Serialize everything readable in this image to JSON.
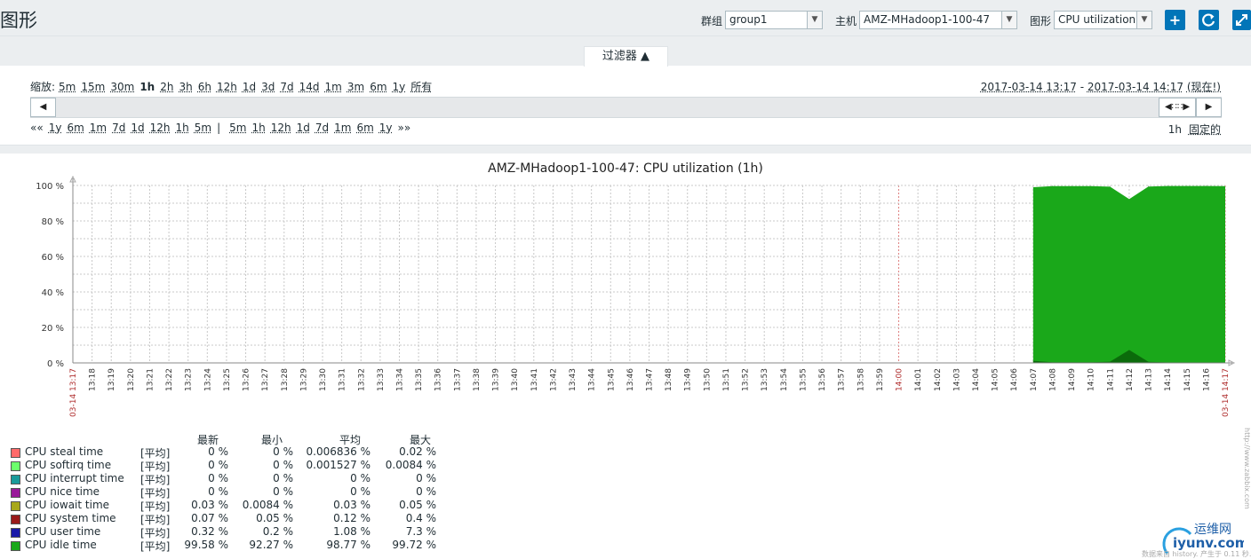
{
  "header": {
    "title": "图形",
    "group_label": "群组",
    "group_value": "group1",
    "host_label": "主机",
    "host_value": "AMZ-MHadoop1-100-47",
    "graph_label": "图形",
    "graph_value": "CPU utilization",
    "buttons": [
      "add",
      "refresh",
      "fullscreen"
    ]
  },
  "filter": {
    "tab_label": "过滤器 ▲",
    "zoom_label": "缩放:",
    "zoom_options": [
      "5m",
      "15m",
      "30m",
      "1h",
      "2h",
      "3h",
      "6h",
      "12h",
      "1d",
      "3d",
      "7d",
      "14d",
      "1m",
      "3m",
      "6m",
      "1y",
      "所有"
    ],
    "zoom_active": "1h",
    "range_from": "2017-03-14 13:17",
    "range_sep": " - ",
    "range_to": "2017-03-14 14:17",
    "range_now": "(现在!)",
    "nav_back_prefix": "««",
    "nav_back": [
      "1y",
      "6m",
      "1m",
      "7d",
      "1d",
      "12h",
      "1h",
      "5m"
    ],
    "nav_sep": "|",
    "nav_fwd": [
      "5m",
      "1h",
      "12h",
      "1d",
      "7d",
      "1m",
      "6m",
      "1y"
    ],
    "nav_fwd_suffix": "»»",
    "period_label": "1h",
    "fixed_label": "固定的"
  },
  "chart_data": {
    "type": "area",
    "title": "AMZ-MHadoop1-100-47: CPU utilization (1h)",
    "y_ticks": [
      "0 %",
      "20 %",
      "40 %",
      "60 %",
      "80 %",
      "100 %"
    ],
    "ylim": [
      0,
      100
    ],
    "x_labels": [
      "03-14 13:17",
      "13:18",
      "13:19",
      "13:20",
      "13:21",
      "13:22",
      "13:23",
      "13:24",
      "13:25",
      "13:26",
      "13:27",
      "13:28",
      "13:29",
      "13:30",
      "13:31",
      "13:32",
      "13:33",
      "13:34",
      "13:35",
      "13:36",
      "13:37",
      "13:38",
      "13:39",
      "13:40",
      "13:41",
      "13:42",
      "13:43",
      "13:44",
      "13:45",
      "13:46",
      "13:47",
      "13:48",
      "13:49",
      "13:50",
      "13:51",
      "13:52",
      "13:53",
      "13:54",
      "13:55",
      "13:56",
      "13:57",
      "13:58",
      "13:59",
      "14:00",
      "14:01",
      "14:02",
      "14:03",
      "14:04",
      "14:05",
      "14:06",
      "14:07",
      "14:08",
      "14:09",
      "14:10",
      "14:11",
      "14:12",
      "14:13",
      "14:14",
      "14:15",
      "14:16",
      "03-14 14:17"
    ],
    "highlight_labels": [
      "03-14 13:17",
      "14:00",
      "03-14 14:17"
    ],
    "total_series": {
      "name": "CPU idle time",
      "color": "#1aa81a",
      "x": [
        "14:07",
        "14:08",
        "14:09",
        "14:10",
        "14:11",
        "14:12",
        "14:13",
        "14:14",
        "14:15",
        "14:16",
        "14:17"
      ],
      "values": [
        99,
        99.6,
        99.6,
        99.6,
        99.3,
        92.3,
        99.4,
        99.7,
        99.7,
        99.7,
        99.6
      ]
    },
    "user_series": {
      "name": "CPU user time",
      "color": "#0b6b0b",
      "x": [
        "14:07",
        "14:08",
        "14:09",
        "14:10",
        "14:11",
        "14:12",
        "14:13",
        "14:14",
        "14:15",
        "14:16",
        "14:17"
      ],
      "values": [
        1.2,
        0.4,
        0.4,
        0.4,
        0.7,
        7.3,
        0.6,
        0.3,
        0.3,
        0.3,
        0.3
      ]
    }
  },
  "legend": {
    "headers": [
      "最新",
      "最小",
      "平均",
      "最大"
    ],
    "rows": [
      {
        "name": "CPU steal time",
        "func": "[平均]",
        "last": "0 %",
        "min": "0 %",
        "avg": "0.006836 %",
        "max": "0.02 %",
        "color": "#ff6a6a"
      },
      {
        "name": "CPU softirq time",
        "func": "[平均]",
        "last": "0 %",
        "min": "0 %",
        "avg": "0.001527 %",
        "max": "0.0084 %",
        "color": "#6cff6c"
      },
      {
        "name": "CPU interrupt time",
        "func": "[平均]",
        "last": "0 %",
        "min": "0 %",
        "avg": "0 %",
        "max": "0 %",
        "color": "#1a9a9a"
      },
      {
        "name": "CPU nice time",
        "func": "[平均]",
        "last": "0 %",
        "min": "0 %",
        "avg": "0 %",
        "max": "0 %",
        "color": "#9a1a9a"
      },
      {
        "name": "CPU iowait time",
        "func": "[平均]",
        "last": "0.03 %",
        "min": "0.0084 %",
        "avg": "0.03 %",
        "max": "0.05 %",
        "color": "#a8a81a"
      },
      {
        "name": "CPU system time",
        "func": "[平均]",
        "last": "0.07 %",
        "min": "0.05 %",
        "avg": "0.12 %",
        "max": "0.4 %",
        "color": "#9a1a1a"
      },
      {
        "name": "CPU user time",
        "func": "[平均]",
        "last": "0.32 %",
        "min": "0.2 %",
        "avg": "1.08 %",
        "max": "7.3 %",
        "color": "#1a1aa8"
      },
      {
        "name": "CPU idle time",
        "func": "[平均]",
        "last": "99.58 %",
        "min": "92.27 %",
        "avg": "98.77 %",
        "max": "99.72 %",
        "color": "#1aa81a"
      }
    ]
  },
  "watermark": "http://www.zabbix.com",
  "logo_text": "运维网",
  "logo_sub": "iyunv.com",
  "footer_note": "数据来自 history. 产生于 0.11 秒."
}
